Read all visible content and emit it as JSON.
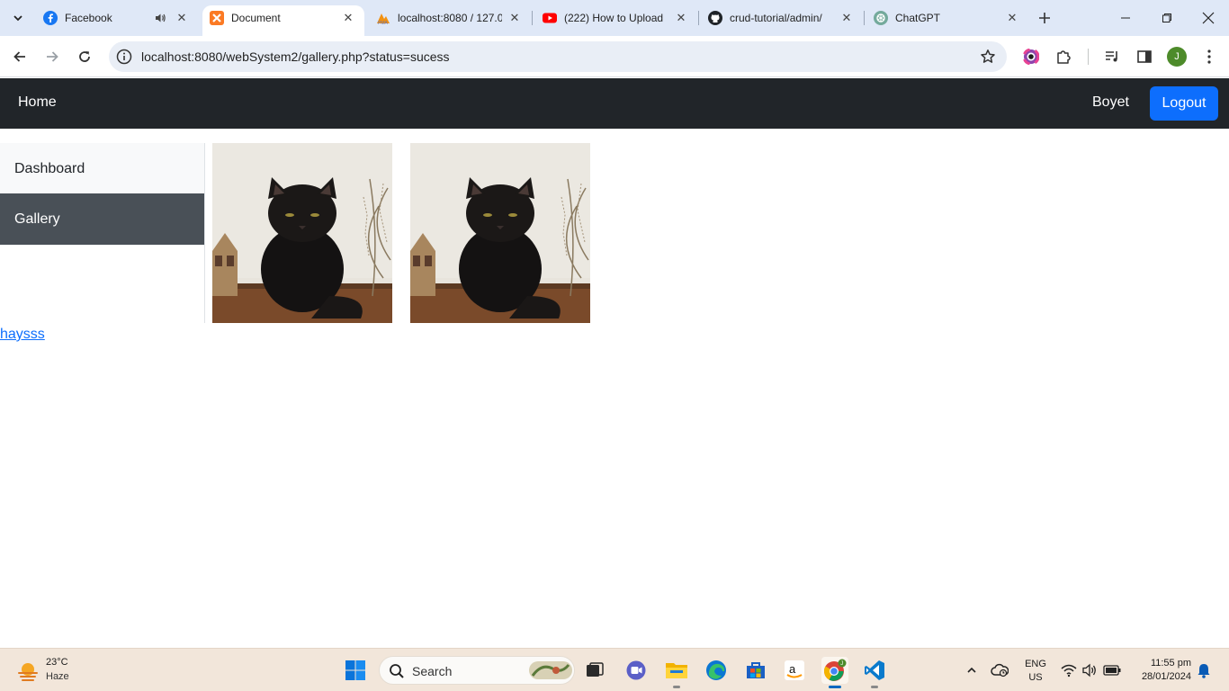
{
  "browser": {
    "tabs": [
      {
        "title": "Facebook",
        "icon": "facebook-icon",
        "audio": true
      },
      {
        "title": "Document",
        "icon": "xampp-icon",
        "active": true
      },
      {
        "title": "localhost:8080 / 127.0",
        "icon": "phpmyadmin-icon"
      },
      {
        "title": "(222) How to Upload",
        "icon": "youtube-icon"
      },
      {
        "title": "crud-tutorial/admin/",
        "icon": "github-icon"
      },
      {
        "title": "ChatGPT",
        "icon": "chatgpt-icon"
      }
    ],
    "url": "localhost:8080/webSystem2/gallery.php?status=sucess",
    "profile_initial": "J"
  },
  "navbar": {
    "home": "Home",
    "user": "Boyet",
    "logout": "Logout",
    "brand_color": "#212529",
    "button_color": "#0d6efd"
  },
  "sidebar": {
    "items": [
      {
        "label": "Dashboard",
        "active": false
      },
      {
        "label": "Gallery",
        "active": true
      }
    ]
  },
  "gallery": {
    "images": [
      {
        "subject": "black cat"
      },
      {
        "subject": "black cat"
      }
    ]
  },
  "footer_link": "haysss",
  "taskbar": {
    "weather_temp": "23°C",
    "weather_desc": "Haze",
    "search_placeholder": "Search",
    "lang_1": "ENG",
    "lang_2": "US",
    "time": "11:55 pm",
    "date": "28/01/2024"
  }
}
